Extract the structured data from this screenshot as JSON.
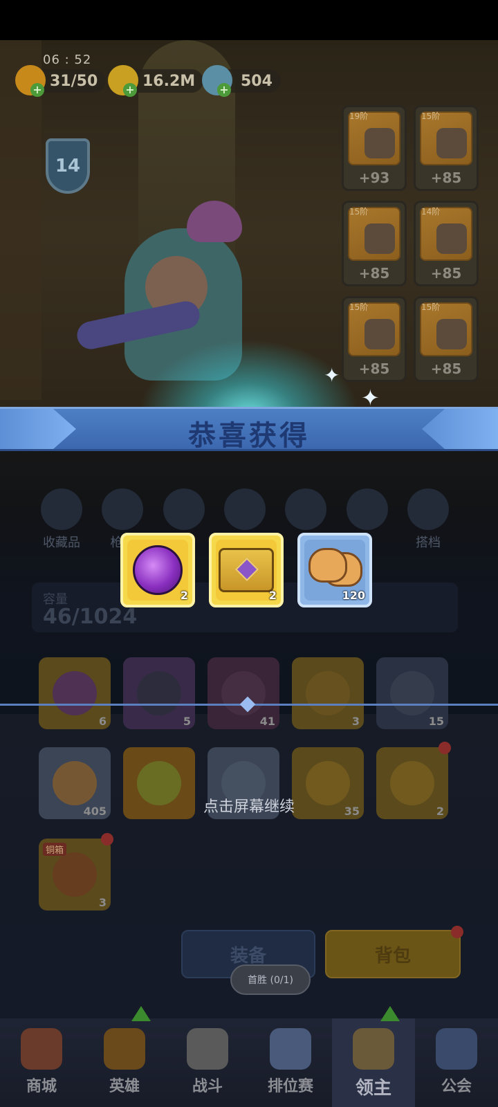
{
  "status": {
    "time": "06 : 52"
  },
  "resources": {
    "energy": {
      "value": "31/50",
      "icon": "flame-icon",
      "color": "#c78a1a"
    },
    "gold": {
      "value": "16.2M",
      "icon": "coin-icon",
      "color": "#c9a021"
    },
    "gems": {
      "value": "504",
      "icon": "crystal-icon",
      "color": "#5a8fa6"
    }
  },
  "player": {
    "level": "14"
  },
  "equipment": [
    {
      "tier": "19阶",
      "bonus": "+93",
      "item": "helmet-icon"
    },
    {
      "tier": "15阶",
      "bonus": "+85",
      "item": "armor-icon"
    },
    {
      "tier": "15阶",
      "bonus": "+85",
      "item": "boots-icon"
    },
    {
      "tier": "14阶",
      "bonus": "+85",
      "item": "gauntlet-icon"
    },
    {
      "tier": "15阶",
      "bonus": "+85",
      "item": "cape-icon"
    },
    {
      "tier": "15阶",
      "bonus": "+85",
      "item": "skirt-icon"
    }
  ],
  "reward_dialog": {
    "title": "恭喜获得",
    "items": [
      {
        "name": "purple-orb-icon",
        "count": "2",
        "frame": "gold"
      },
      {
        "name": "treasure-chest-icon",
        "count": "2",
        "frame": "gold"
      },
      {
        "name": "cat-cookie-icon",
        "count": "120",
        "frame": "blue"
      }
    ],
    "continue_text": "点击屏幕继续"
  },
  "categories": [
    {
      "label": "收藏品",
      "icon": "feather-icon"
    },
    {
      "label": "枪械",
      "icon": "gun-icon"
    },
    {
      "label": "",
      "icon": "clothes-icon"
    },
    {
      "label": "",
      "icon": "badge-icon"
    },
    {
      "label": "",
      "icon": "crown-icon"
    },
    {
      "label": "",
      "icon": "statue-icon"
    },
    {
      "label": "搭档",
      "icon": "partner-icon"
    }
  ],
  "capacity": {
    "label": "容量",
    "value": "46/1024"
  },
  "inventory": [
    {
      "count": "6",
      "frame": "#5b4a1c",
      "art": "#4a2a66",
      "icon": "purple-orb-icon"
    },
    {
      "count": "5",
      "frame": "#3a2a4a",
      "art": "#2a2e3a",
      "icon": "cat-figure-icon"
    },
    {
      "count": "41",
      "frame": "#3a2438",
      "art": "#4a3244",
      "icon": "purple-chest-icon"
    },
    {
      "count": "3",
      "frame": "#5b4a1c",
      "art": "#6a5420",
      "icon": "scroll-icon"
    },
    {
      "count": "15",
      "frame": "#2a3142",
      "art": "#3a4252",
      "icon": "fairy-icon"
    },
    {
      "count": "405",
      "frame": "#3b4556",
      "art": "#8a5e2a",
      "icon": "cat-cookie-icon"
    },
    {
      "count": "",
      "frame": "#6a4a16",
      "art": "#6a7a2a",
      "icon": "honey-jar-icon"
    },
    {
      "count": "",
      "frame": "#3b4556",
      "art": "#4a5466",
      "icon": "silver-chest-icon"
    },
    {
      "count": "35",
      "frame": "#5b4a1c",
      "art": "#7a6020",
      "icon": "gold-chest-icon"
    },
    {
      "count": "2",
      "frame": "#5b4a1c",
      "art": "#7a6020",
      "icon": "treasure-chest-icon",
      "dot": true
    },
    {
      "count": "3",
      "frame": "#5b4a1c",
      "art": "#6b3a22",
      "icon": "bronze-chest-icon",
      "dot": true,
      "tag": "铜箱"
    }
  ],
  "buttons": {
    "equip": "装备",
    "bag": "背包"
  },
  "tooltip": "首胜 (0/1)",
  "nav": [
    {
      "label": "商城",
      "icon": "shop-icon",
      "color": "#6a3a2a"
    },
    {
      "label": "英雄",
      "icon": "hero-card-icon",
      "color": "#6a4a1a",
      "up": true
    },
    {
      "label": "战斗",
      "icon": "crossed-swords-icon",
      "color": "#5a5a5a"
    },
    {
      "label": "排位赛",
      "icon": "rank-shield-icon",
      "color": "#4a5a7a"
    },
    {
      "label": "领主",
      "icon": "lord-banner-icon",
      "color": "#6a5a3a",
      "active": true,
      "up": true
    },
    {
      "label": "公会",
      "icon": "guild-castle-icon",
      "color": "#3a4a6a"
    }
  ]
}
